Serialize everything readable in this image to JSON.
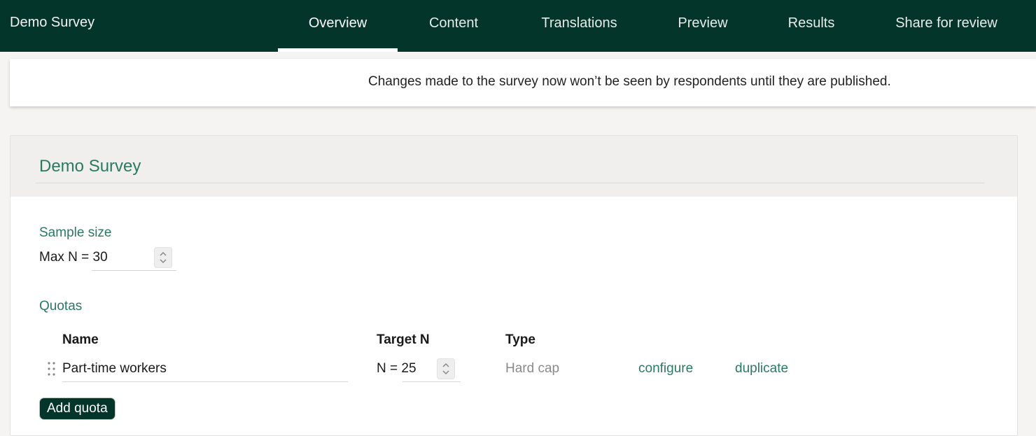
{
  "app": {
    "title": "Demo Survey"
  },
  "nav": {
    "tabs": [
      {
        "label": "Overview",
        "active": true
      },
      {
        "label": "Content"
      },
      {
        "label": "Translations"
      },
      {
        "label": "Preview"
      },
      {
        "label": "Results"
      },
      {
        "label": "Share for review"
      }
    ]
  },
  "notice": {
    "text": "Changes made to the survey now won’t be seen by respondents until they are published."
  },
  "survey": {
    "title": "Demo Survey",
    "sample_size": {
      "label": "Sample size",
      "value_text": "Max N = 30"
    },
    "quotas": {
      "label": "Quotas",
      "columns": {
        "name": "Name",
        "target": "Target N",
        "type": "Type"
      },
      "rows": [
        {
          "name": "Part-time workers",
          "target_text": "N = 25",
          "type": "Hard cap",
          "configure_label": "configure",
          "duplicate_label": "duplicate"
        }
      ],
      "add_label": "Add quota"
    }
  },
  "colors": {
    "brand_dark": "#04352a",
    "accent_green": "#2a7a63"
  }
}
